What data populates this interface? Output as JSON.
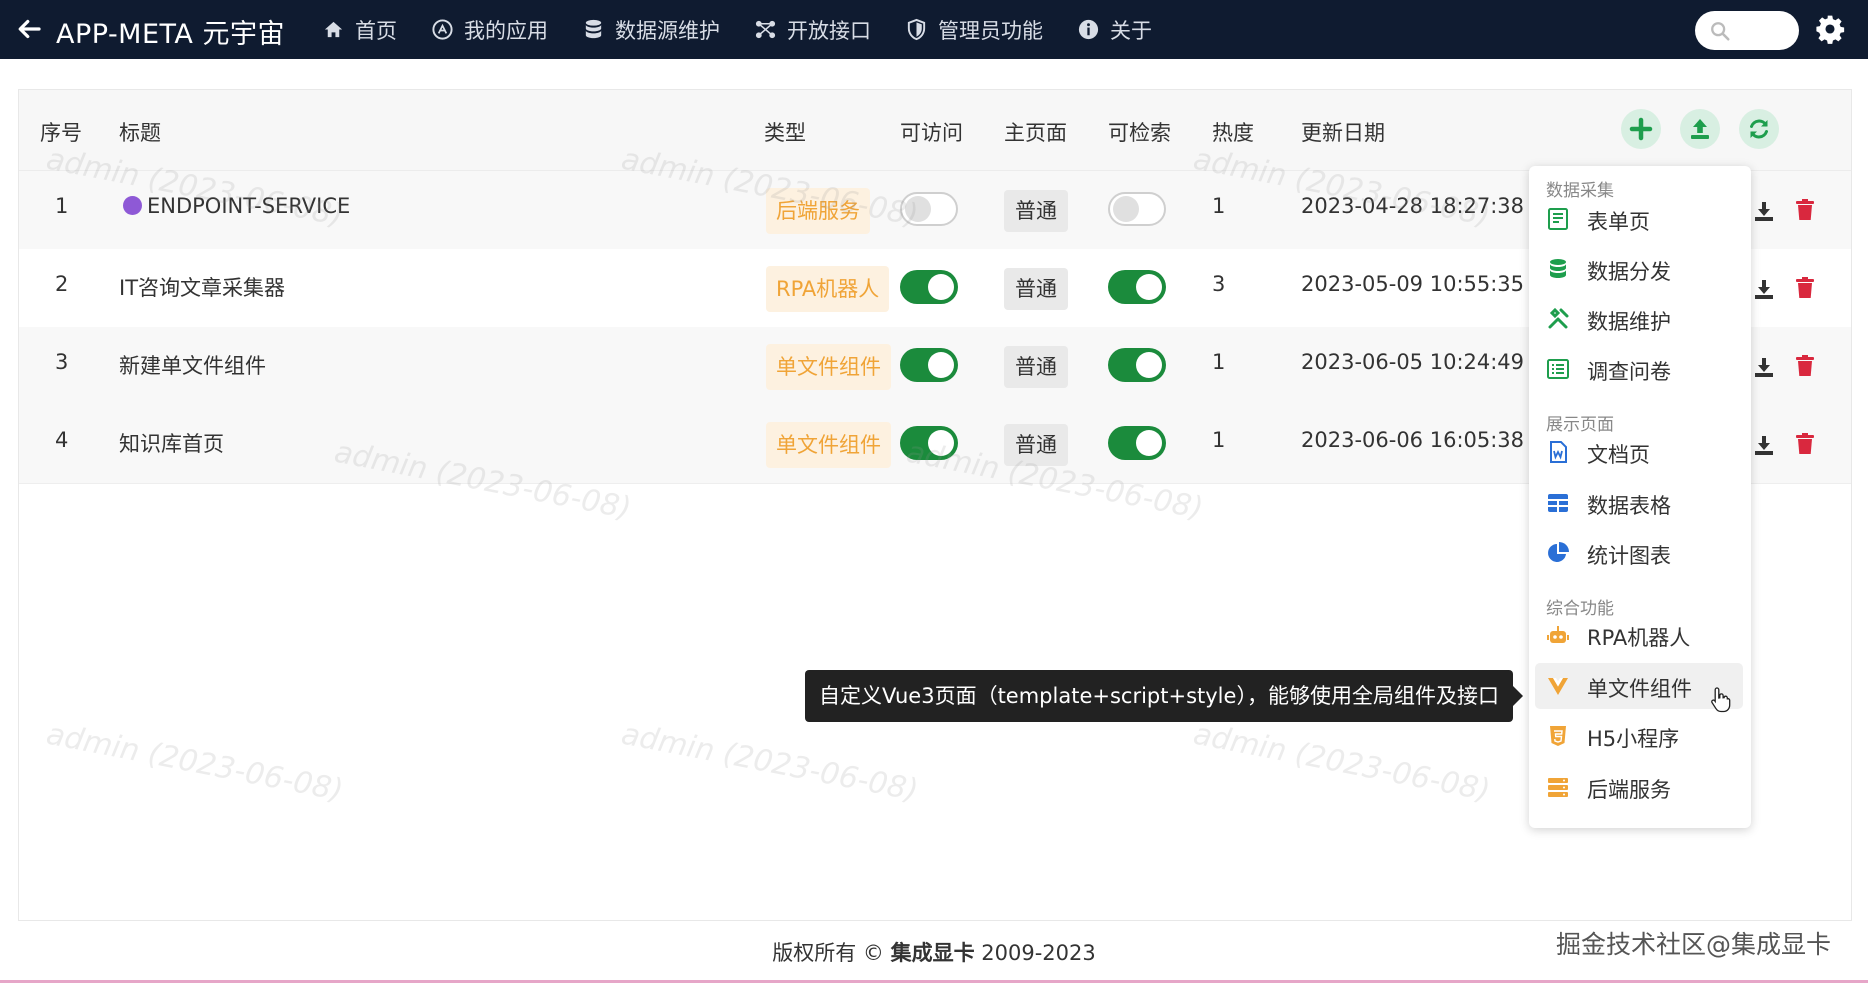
{
  "header": {
    "title": "APP-META 元宇宙",
    "nav": [
      {
        "label": "首页",
        "icon": "home-icon"
      },
      {
        "label": "我的应用",
        "icon": "app-store-icon"
      },
      {
        "label": "数据源维护",
        "icon": "database-icon"
      },
      {
        "label": "开放接口",
        "icon": "api-icon"
      },
      {
        "label": "管理员功能",
        "icon": "shield-icon"
      },
      {
        "label": "关于",
        "icon": "info-icon"
      }
    ],
    "search": {
      "placeholder": ""
    }
  },
  "table": {
    "columns": {
      "index": "序号",
      "title": "标题",
      "type": "类型",
      "accessible": "可访问",
      "homepage": "主页面",
      "searchable": "可检索",
      "heat": "热度",
      "updated": "更新日期"
    },
    "rows": [
      {
        "index": "1",
        "title": "ENDPOINT-SERVICE",
        "type": "后端服务",
        "accessible": false,
        "homepage": "普通",
        "searchable": false,
        "heat": "1",
        "updated": "2023-04-28 18:27:38"
      },
      {
        "index": "2",
        "title": "IT咨询文章采集器",
        "type": "RPA机器人",
        "accessible": true,
        "homepage": "普通",
        "searchable": true,
        "heat": "3",
        "updated": "2023-05-09 10:55:35"
      },
      {
        "index": "3",
        "title": "新建单文件组件",
        "type": "单文件组件",
        "accessible": true,
        "homepage": "普通",
        "searchable": true,
        "heat": "1",
        "updated": "2023-06-05 10:24:49"
      },
      {
        "index": "4",
        "title": "知识库首页",
        "type": "单文件组件",
        "accessible": true,
        "homepage": "普通",
        "searchable": true,
        "heat": "1",
        "updated": "2023-06-06 16:05:38"
      }
    ]
  },
  "dropdown": {
    "groups": [
      {
        "label": "数据采集",
        "items": [
          {
            "label": "表单页",
            "icon": "form-icon"
          },
          {
            "label": "数据分发",
            "icon": "database-icon"
          },
          {
            "label": "数据维护",
            "icon": "tools-icon"
          },
          {
            "label": "调查问卷",
            "icon": "list-icon"
          }
        ]
      },
      {
        "label": "展示页面",
        "items": [
          {
            "label": "文档页",
            "icon": "word-doc-icon"
          },
          {
            "label": "数据表格",
            "icon": "table-icon"
          },
          {
            "label": "统计图表",
            "icon": "pie-chart-icon"
          }
        ]
      },
      {
        "label": "综合功能",
        "items": [
          {
            "label": "RPA机器人",
            "icon": "robot-icon"
          },
          {
            "label": "单文件组件",
            "icon": "vue-icon"
          },
          {
            "label": "H5小程序",
            "icon": "html5-icon"
          },
          {
            "label": "后端服务",
            "icon": "server-icon"
          }
        ]
      }
    ]
  },
  "tooltip": {
    "text": "自定义Vue3页面（template+script+style），能够使用全局组件及接口"
  },
  "watermark": {
    "text": "admin (2023-06-08)"
  },
  "footer": {
    "prefix": "版权所有 © ",
    "brand": "集成显卡",
    "years": " 2009-2023"
  },
  "credit": "掘金技术社区@集成显卡",
  "colors": {
    "nav_bg": "#0f1b30",
    "toggle_on": "#1b8b3c",
    "tag_text": "#f0a437",
    "tag_bg": "#fdf1e0",
    "delete": "#d9283e",
    "accent_green": "#1e9e4d"
  }
}
